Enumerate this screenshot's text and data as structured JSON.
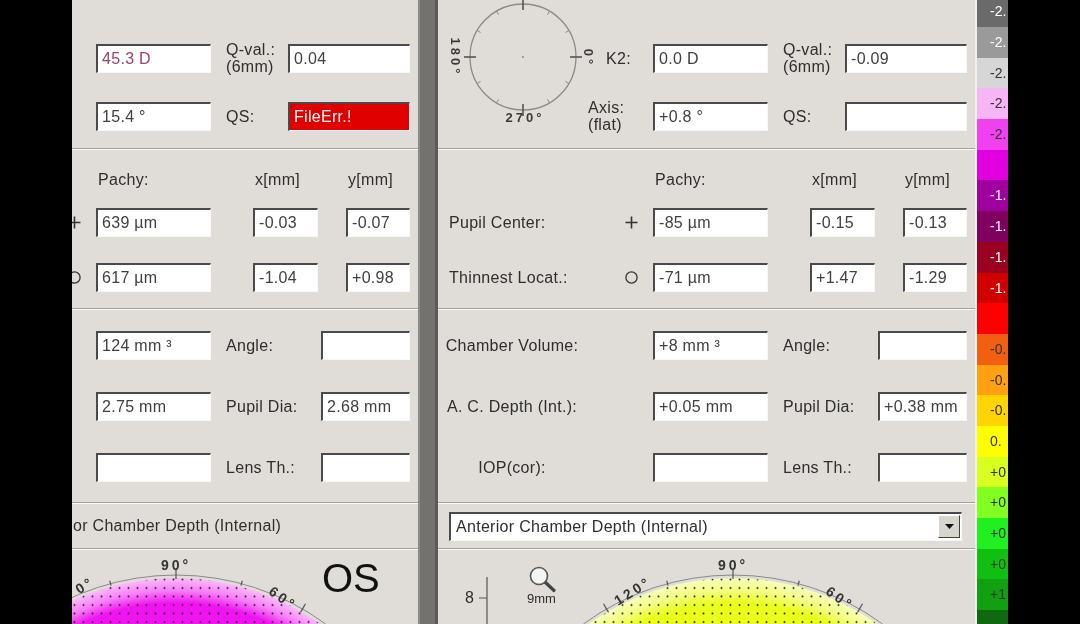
{
  "panels": [
    {
      "keratometry": [
        {
          "value": "45.3 D",
          "color": "#a0406e",
          "label2": "Q-val.: (6mm)",
          "value2": "0.04"
        },
        {
          "value": "15.4 °",
          "label2": "QS:",
          "value2": "FileErr.!",
          "error2": true
        }
      ],
      "pachymetry": {
        "headers": [
          "Pachy:",
          "x[mm]",
          "y[mm]"
        ],
        "rows": [
          {
            "kind": "cross",
            "values": [
              "639 µm",
              "-0.03",
              "-0.07"
            ]
          },
          {
            "kind": "circle",
            "values": [
              "617 µm",
              "-1.04",
              "+0.98"
            ]
          }
        ]
      },
      "chamber": [
        {
          "value": "124 mm ³",
          "label2": "Angle:"
        },
        {
          "value": "2.75 mm",
          "label2": "Pupil Dia:",
          "value2": "2.68 mm"
        },
        {
          "label2": "Lens Th.:"
        }
      ],
      "selector": {
        "kind": "label",
        "text": "or Chamber Depth (Internal)"
      },
      "map": {
        "color": "#f014f0",
        "labels": [
          "0°",
          "90°",
          "60°"
        ],
        "eye": "OS"
      }
    },
    {
      "keratometry": [
        {
          "label": "K2:",
          "value": "0.0 D",
          "label2": "Q-val.: (6mm)",
          "value2": "-0.09"
        },
        {
          "label": "Axis: (flat)",
          "value": "+0.8 °",
          "label2": "QS:",
          "error2": false
        }
      ],
      "dial": {
        "labels": [
          "180°",
          "0°",
          "270°"
        ]
      },
      "pachymetry": {
        "headers": [
          "Pachy:",
          "x[mm]",
          "y[mm]"
        ],
        "rows": [
          {
            "kind": "cross",
            "label": "Pupil Center:",
            "values": [
              "-85 µm",
              "-0.15",
              "-0.13"
            ]
          },
          {
            "kind": "circle",
            "label": "Thinnest Locat.:",
            "values": [
              "-71 µm",
              "+1.47",
              "-1.29"
            ]
          }
        ]
      },
      "chamber": [
        {
          "label": "Chamber Volume:",
          "value": "+8 mm ³",
          "label2": "Angle:"
        },
        {
          "label": "A. C. Depth (Int.):",
          "value": "+0.05 mm",
          "label2": "Pupil Dia:",
          "value2": "+0.38 mm"
        },
        {
          "label": "IOP(cor):",
          "label2": "Lens Th.:"
        }
      ],
      "selector": {
        "kind": "dropdown",
        "value": "Anterior Chamber Depth (Internal)"
      },
      "map": {
        "color": "#eaff1a",
        "labels": [
          "120°",
          "90°",
          "60°"
        ],
        "scale_label": "8",
        "zoom_label": "9mm"
      }
    }
  ],
  "color_scale": [
    {
      "label": "-2.",
      "color": "#6a6a6a"
    },
    {
      "label": "-2.",
      "color": "#9a9a9a"
    },
    {
      "label": "-2.",
      "color": "#d6d6d6"
    },
    {
      "label": "-2.",
      "color": "#f6b6f6"
    },
    {
      "label": "-2.",
      "color": "#f040f0"
    },
    {
      "color": "#e000e0"
    },
    {
      "label": "-1.",
      "color": "#a000a0"
    },
    {
      "label": "-1.",
      "color": "#800060"
    },
    {
      "label": "-1.",
      "color": "#9a0020"
    },
    {
      "label": "-1.",
      "color": "#d00000"
    },
    {
      "color": "#ff0000"
    },
    {
      "label": "-0.",
      "color": "#f06010"
    },
    {
      "label": "-0.",
      "color": "#ffa010"
    },
    {
      "label": "-0.",
      "color": "#ffd400"
    },
    {
      "label": "0.",
      "color": "#ffff00"
    },
    {
      "label": "+0",
      "color": "#d8ff20"
    },
    {
      "label": "+0",
      "color": "#80ff20"
    },
    {
      "label": "+0",
      "color": "#20f020"
    },
    {
      "label": "+0",
      "color": "#10c010"
    },
    {
      "label": "+1",
      "color": "#10a010"
    },
    {
      "color": "#106810"
    }
  ]
}
